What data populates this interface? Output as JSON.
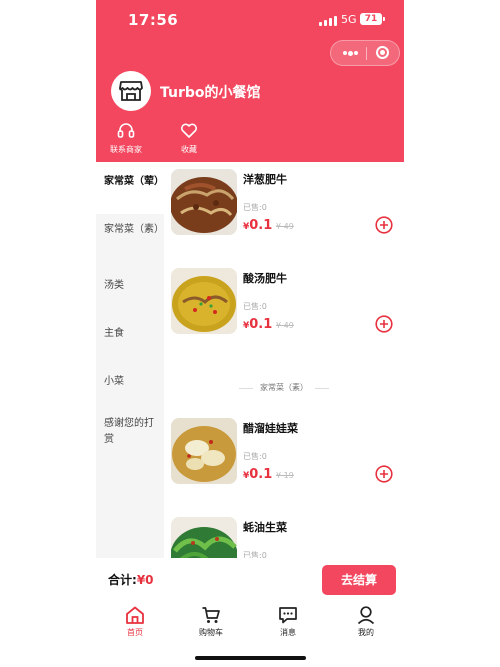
{
  "status_bar": {
    "time": "17:56",
    "network": "5G",
    "battery": "71"
  },
  "header": {
    "shop_name": "Turbo的小餐馆",
    "actions": [
      {
        "label": "联系商家",
        "icon": "headset-icon"
      },
      {
        "label": "收藏",
        "icon": "heart-icon"
      }
    ]
  },
  "sidebar": {
    "items": [
      {
        "label": "家常菜（荤）",
        "active": true
      },
      {
        "label": "家常菜（素）"
      },
      {
        "label": "汤类"
      },
      {
        "label": "主食"
      },
      {
        "label": "小菜"
      },
      {
        "label": "感谢您的打赏"
      }
    ]
  },
  "products": [
    {
      "name": "洋葱肥牛",
      "sold": "已售:0",
      "currency": "¥",
      "price": "0.1",
      "original": "¥ 49"
    },
    {
      "name": "酸汤肥牛",
      "sold": "已售:0",
      "currency": "¥",
      "price": "0.1",
      "original": "¥ 49"
    },
    {
      "name": "醋溜娃娃菜",
      "sold": "已售:0",
      "currency": "¥",
      "price": "0.1",
      "original": "¥ 19"
    },
    {
      "name": "蚝油生菜",
      "sold": "已售:0"
    }
  ],
  "section_divider": "家常菜（素）",
  "cart": {
    "total_label": "合计:",
    "total_value": "¥0",
    "checkout_label": "去结算"
  },
  "tabbar": {
    "items": [
      {
        "label": "首页",
        "icon": "home-icon",
        "active": true
      },
      {
        "label": "购物车",
        "icon": "cart-icon"
      },
      {
        "label": "消息",
        "icon": "message-icon"
      },
      {
        "label": "我的",
        "icon": "user-icon"
      }
    ]
  },
  "colors": {
    "brand": "#f2475e",
    "price": "#e8313f"
  }
}
